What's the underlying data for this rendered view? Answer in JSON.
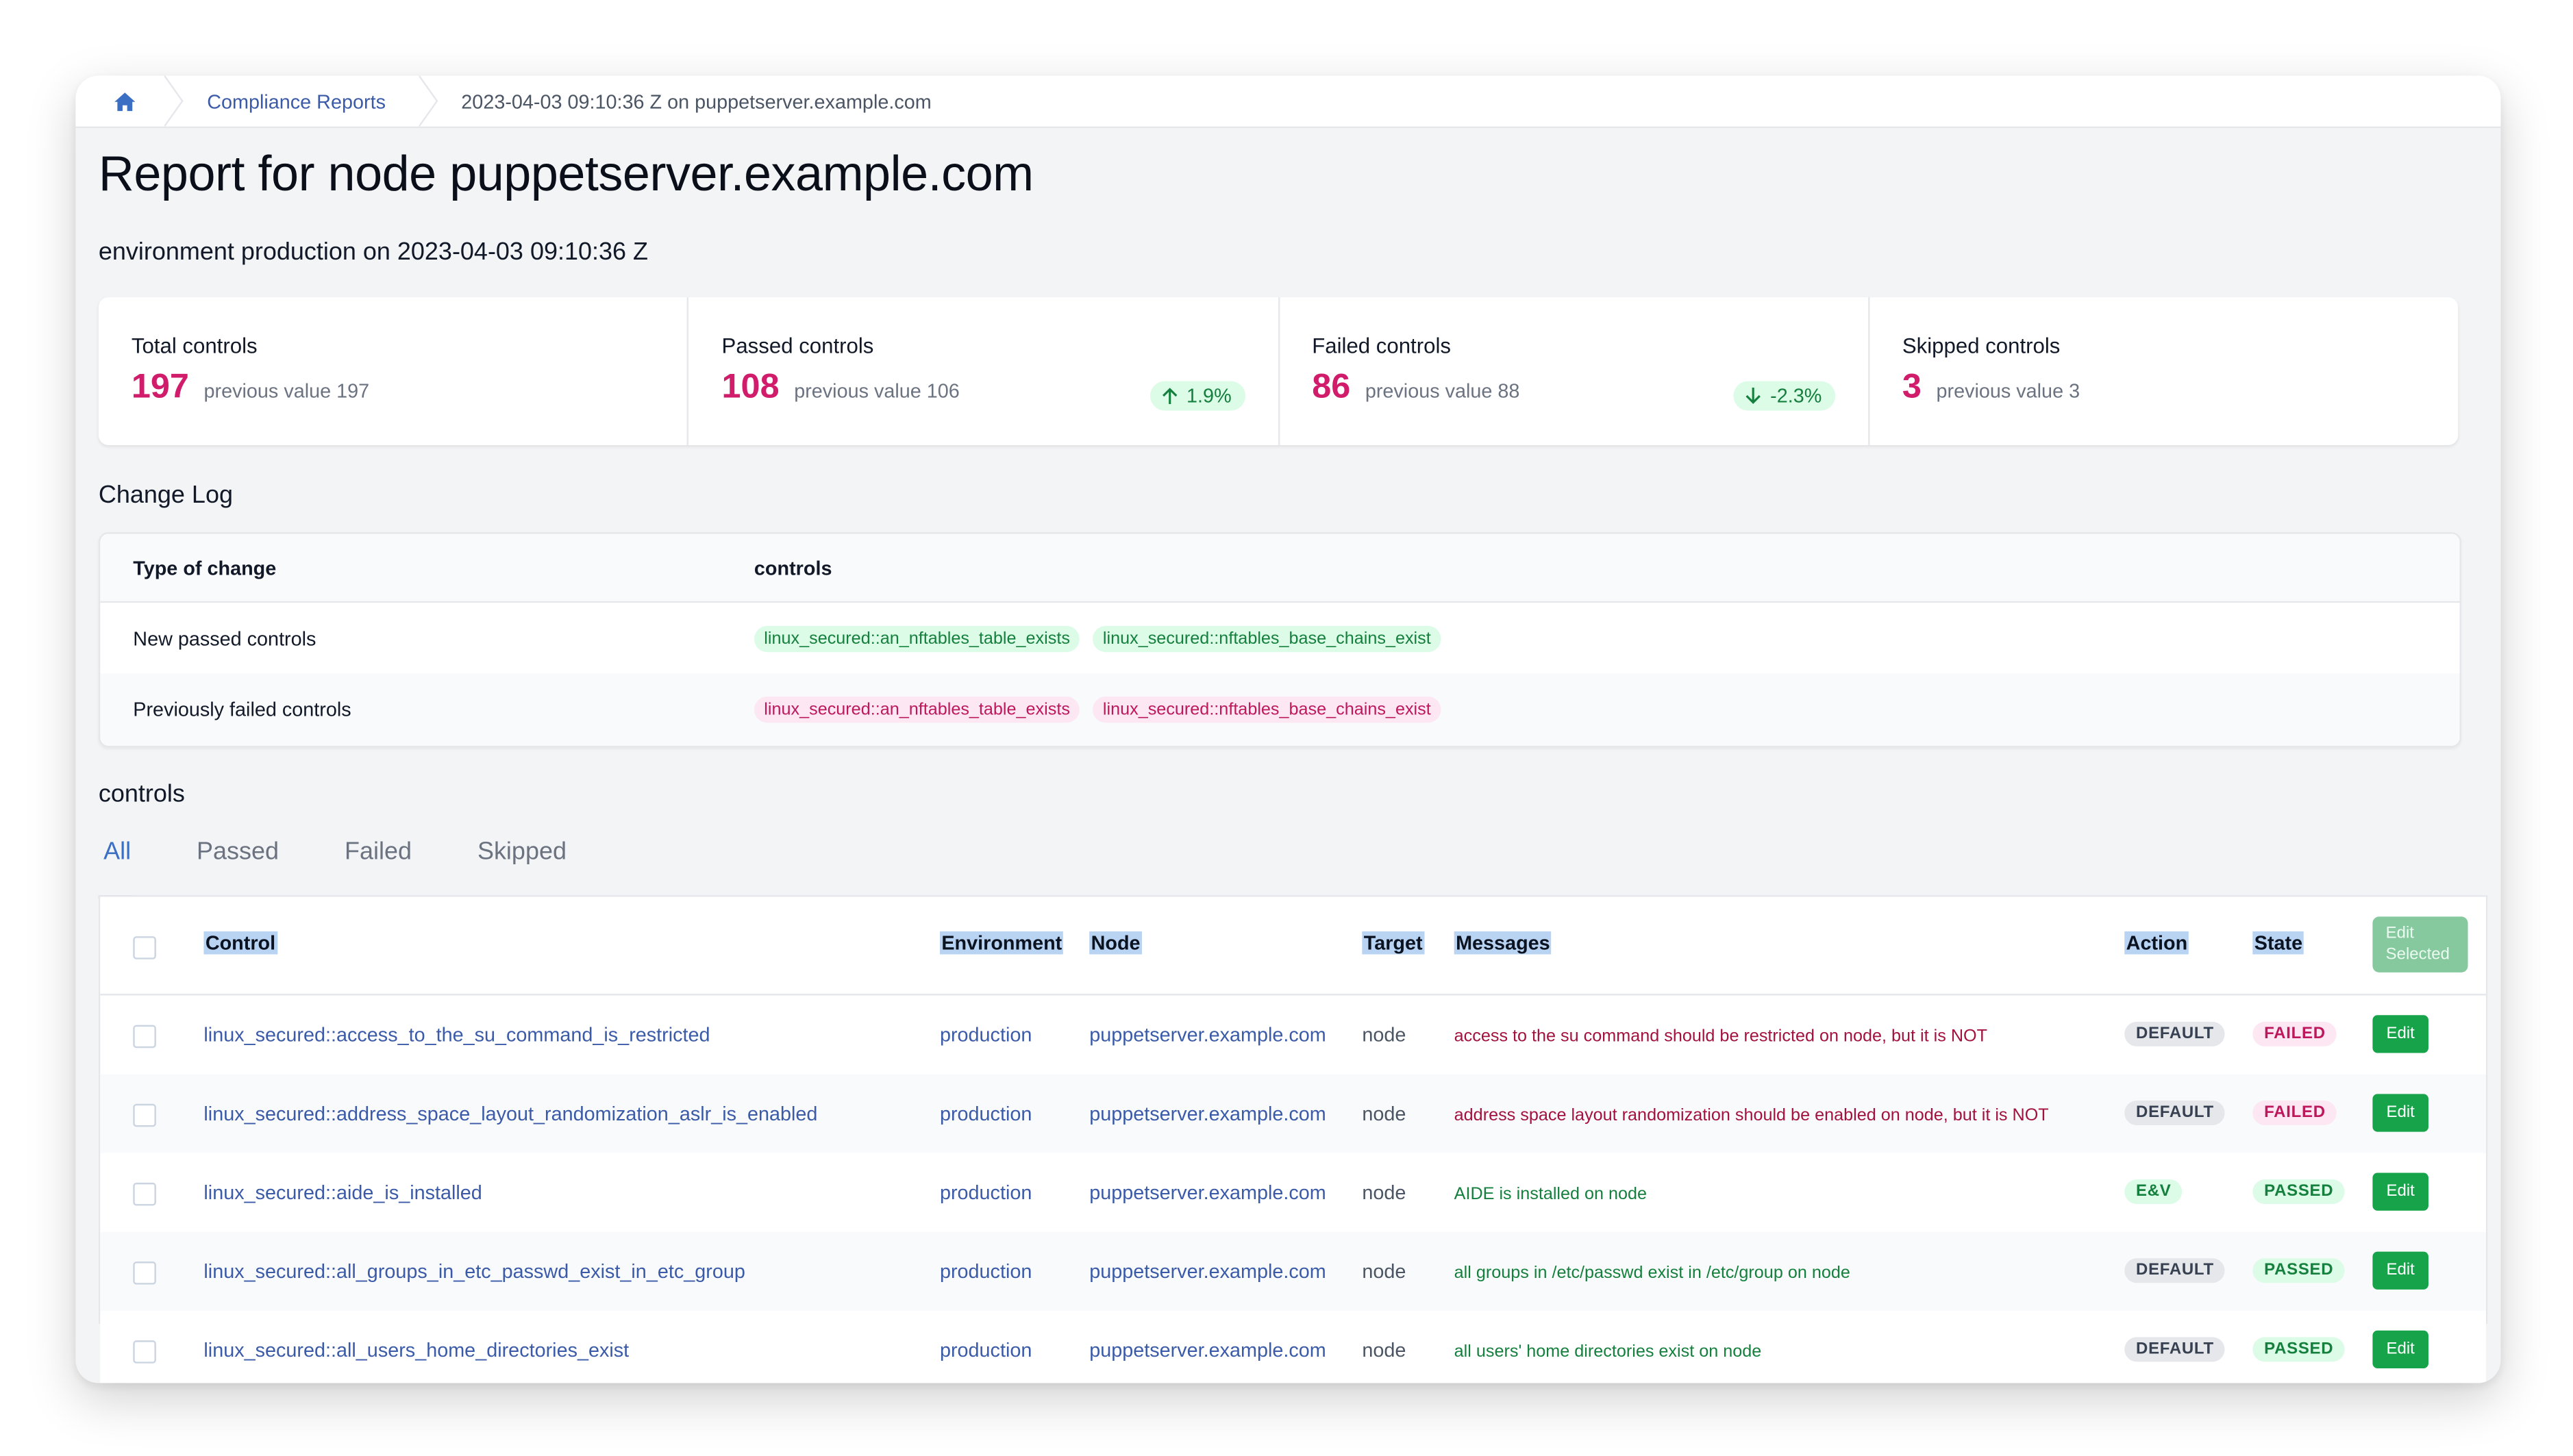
{
  "breadcrumb": {
    "home_icon": "home-icon",
    "reports_label": "Compliance Reports",
    "current_label": "2023-04-03 09:10:36 Z on puppetserver.example.com"
  },
  "page": {
    "title": "Report for node puppetserver.example.com",
    "subtitle": "environment production on 2023-04-03 09:10:36 Z"
  },
  "stats": [
    {
      "label": "Total controls",
      "value": "197",
      "previous": "previous value 197",
      "delta": null
    },
    {
      "label": "Passed controls",
      "value": "108",
      "previous": "previous value 106",
      "delta": "1.9%",
      "delta_direction": "up"
    },
    {
      "label": "Failed controls",
      "value": "86",
      "previous": "previous value 88",
      "delta": "-2.3%",
      "delta_direction": "down"
    },
    {
      "label": "Skipped controls",
      "value": "3",
      "previous": "previous value 3",
      "delta": null
    }
  ],
  "changelog": {
    "title": "Change Log",
    "header_type": "Type of change",
    "header_controls": "controls",
    "rows": [
      {
        "type": "New passed controls",
        "controls": [
          "linux_secured::an_nftables_table_exists",
          "linux_secured::nftables_base_chains_exist"
        ]
      },
      {
        "type": "Previously failed controls",
        "controls": [
          "linux_secured::an_nftables_table_exists",
          "linux_secured::nftables_base_chains_exist"
        ]
      }
    ]
  },
  "controls": {
    "title": "controls",
    "tabs": [
      "All",
      "Passed",
      "Failed",
      "Skipped"
    ],
    "active_tab": "All",
    "headers": {
      "control": "Control",
      "environment": "Environment",
      "node": "Node",
      "target": "Target",
      "messages": "Messages",
      "action": "Action",
      "state": "State",
      "edit_selected": "Edit Selected"
    },
    "rows": [
      {
        "control": "linux_secured::access_to_the_su_command_is_restricted",
        "environment": "production",
        "node": "puppetserver.example.com",
        "target": "node",
        "message": "access to the su command should be restricted on node, but it is NOT",
        "action": "DEFAULT",
        "state": "FAILED",
        "edit": "Edit"
      },
      {
        "control": "linux_secured::address_space_layout_randomization_aslr_is_enabled",
        "environment": "production",
        "node": "puppetserver.example.com",
        "target": "node",
        "message": "address space layout randomization should be enabled on node, but it is NOT",
        "action": "DEFAULT",
        "state": "FAILED",
        "edit": "Edit"
      },
      {
        "control": "linux_secured::aide_is_installed",
        "environment": "production",
        "node": "puppetserver.example.com",
        "target": "node",
        "message": "AIDE is installed on node",
        "action": "E&V",
        "state": "PASSED",
        "edit": "Edit"
      },
      {
        "control": "linux_secured::all_groups_in_etc_passwd_exist_in_etc_group",
        "environment": "production",
        "node": "puppetserver.example.com",
        "target": "node",
        "message": "all groups in /etc/passwd exist in /etc/group on node",
        "action": "DEFAULT",
        "state": "PASSED",
        "edit": "Edit"
      },
      {
        "control": "linux_secured::all_users_home_directories_exist",
        "environment": "production",
        "node": "puppetserver.example.com",
        "target": "node",
        "message": "all users' home directories exist on node",
        "action": "DEFAULT",
        "state": "PASSED",
        "edit": "Edit"
      }
    ]
  },
  "colors": {
    "accent": "#3b6fc4",
    "value_pink": "#d01c6b",
    "pass_green": "#15803d",
    "fail_pink": "#be185d",
    "button_green": "#16a34a"
  }
}
